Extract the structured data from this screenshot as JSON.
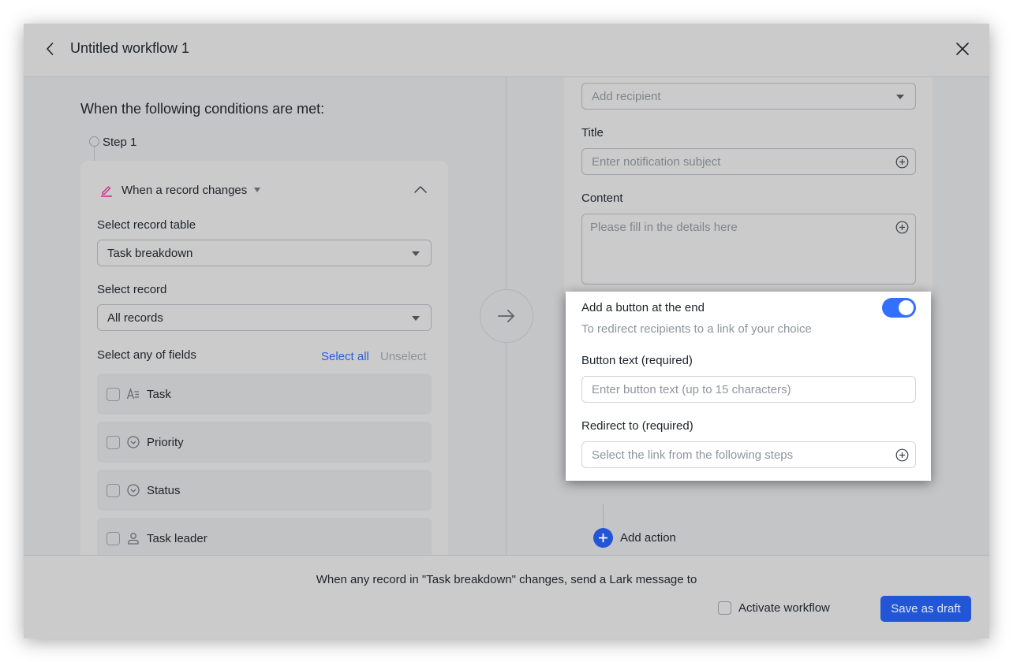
{
  "header": {
    "title": "Untitled workflow 1"
  },
  "left": {
    "conditions_title": "When the following conditions are met:",
    "step_label": "Step 1",
    "trigger": {
      "label": "When a record changes",
      "icon": "pencil-icon",
      "icon_color": "#d6338a"
    },
    "record_table": {
      "label": "Select record table",
      "value": "Task breakdown"
    },
    "record": {
      "label": "Select record",
      "value": "All records"
    },
    "fields": {
      "label": "Select any of fields",
      "select_all": "Select all",
      "unselect": "Unselect",
      "items": [
        {
          "name": "Task",
          "icon": "text-field-icon",
          "checked": false
        },
        {
          "name": "Priority",
          "icon": "single-select-icon",
          "checked": false
        },
        {
          "name": "Status",
          "icon": "single-select-icon",
          "checked": false
        },
        {
          "name": "Task leader",
          "icon": "person-icon",
          "checked": false
        }
      ]
    }
  },
  "right": {
    "recipient": {
      "placeholder": "Add recipient"
    },
    "title": {
      "label": "Title",
      "placeholder": "Enter notification subject"
    },
    "content": {
      "label": "Content",
      "placeholder": "Please fill in the details here"
    },
    "button_section": {
      "title": "Add a button at the end",
      "subtitle": "To redirect recipients to a link of your choice",
      "toggle_on": true,
      "button_text_label": "Button text (required)",
      "button_text_placeholder": "Enter button text (up to 15 characters)",
      "redirect_label": "Redirect to (required)",
      "redirect_placeholder": "Select the link from the following steps"
    },
    "add_action": "Add action"
  },
  "footer": {
    "summary": "When any record in \"Task breakdown\" changes, send a Lark message to",
    "activate_label": "Activate workflow",
    "activate_checked": false,
    "save_label": "Save as draft"
  },
  "colors": {
    "accent": "#2356d6",
    "toggle": "#3370ff",
    "link": "#2a5fd8"
  }
}
